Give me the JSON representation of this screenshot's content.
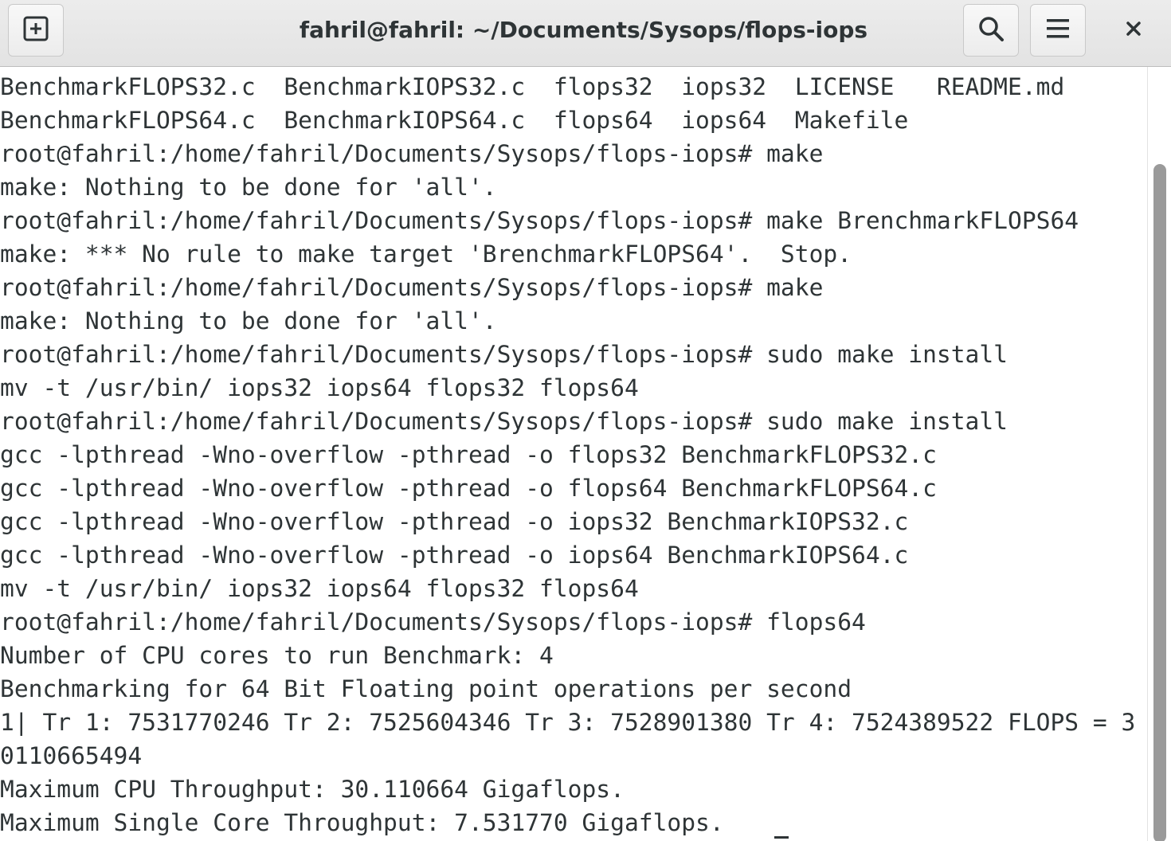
{
  "window": {
    "title": "fahril@fahril: ~/Documents/Sysops/flops-iops"
  },
  "icons": {
    "new_tab": "new-tab-icon",
    "search": "search-icon",
    "menu": "hamburger-menu-icon",
    "close": "close-icon"
  },
  "colors": {
    "text": "#2e3436",
    "background": "#ffffff",
    "headerbar": "#e6e6e6"
  },
  "terminal": {
    "lines": [
      "BenchmarkFLOPS32.c  BenchmarkIOPS32.c  flops32  iops32  LICENSE   README.md",
      "BenchmarkFLOPS64.c  BenchmarkIOPS64.c  flops64  iops64  Makefile",
      "root@fahril:/home/fahril/Documents/Sysops/flops-iops# make",
      "make: Nothing to be done for 'all'.",
      "root@fahril:/home/fahril/Documents/Sysops/flops-iops# make BrenchmarkFLOPS64",
      "make: *** No rule to make target 'BrenchmarkFLOPS64'.  Stop.",
      "root@fahril:/home/fahril/Documents/Sysops/flops-iops# make",
      "make: Nothing to be done for 'all'.",
      "root@fahril:/home/fahril/Documents/Sysops/flops-iops# sudo make install",
      "mv -t /usr/bin/ iops32 iops64 flops32 flops64",
      "root@fahril:/home/fahril/Documents/Sysops/flops-iops# sudo make install",
      "gcc -lpthread -Wno-overflow -pthread -o flops32 BenchmarkFLOPS32.c",
      "gcc -lpthread -Wno-overflow -pthread -o flops64 BenchmarkFLOPS64.c",
      "gcc -lpthread -Wno-overflow -pthread -o iops32 BenchmarkIOPS32.c",
      "gcc -lpthread -Wno-overflow -pthread -o iops64 BenchmarkIOPS64.c",
      "mv -t /usr/bin/ iops32 iops64 flops32 flops64",
      "root@fahril:/home/fahril/Documents/Sysops/flops-iops# flops64",
      "Number of CPU cores to run Benchmark: 4",
      "Benchmarking for 64 Bit Floating point operations per second",
      "1| Tr 1: 7531770246 Tr 2: 7525604346 Tr 3: 7528901380 Tr 4: 7524389522 FLOPS = 3",
      "0110665494",
      "Maximum CPU Throughput: 30.110664 Gigaflops.",
      "Maximum Single Core Throughput: 7.531770 Gigaflops."
    ]
  }
}
